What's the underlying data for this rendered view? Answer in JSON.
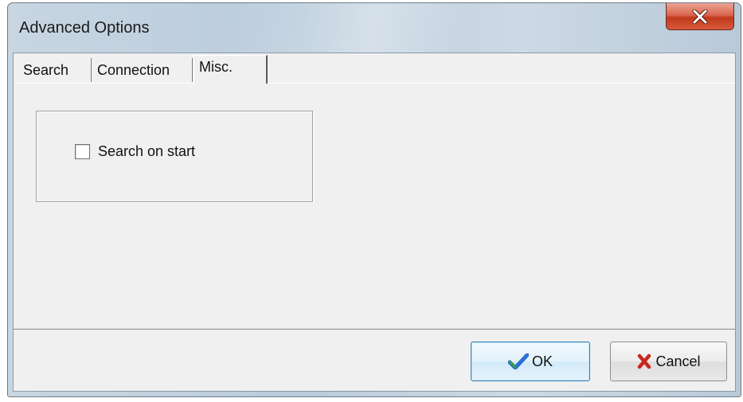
{
  "window": {
    "title": "Advanced Options",
    "close_icon": "close-x-icon"
  },
  "tabs": [
    {
      "label": "Search",
      "active": false
    },
    {
      "label": "Connection",
      "active": false
    },
    {
      "label": "Misc.",
      "active": true
    }
  ],
  "misc_page": {
    "search_on_start": {
      "label": "Search on start",
      "checked": false
    }
  },
  "buttons": {
    "ok_label": "OK",
    "ok_icon": "checkmark-icon",
    "cancel_label": "Cancel",
    "cancel_icon": "red-x-icon"
  },
  "colors": {
    "close_button": "#c2391d",
    "checkmark_blue": "#2a6fd1",
    "checkmark_green": "#3aa23a",
    "cancel_red": "#c8281c"
  }
}
